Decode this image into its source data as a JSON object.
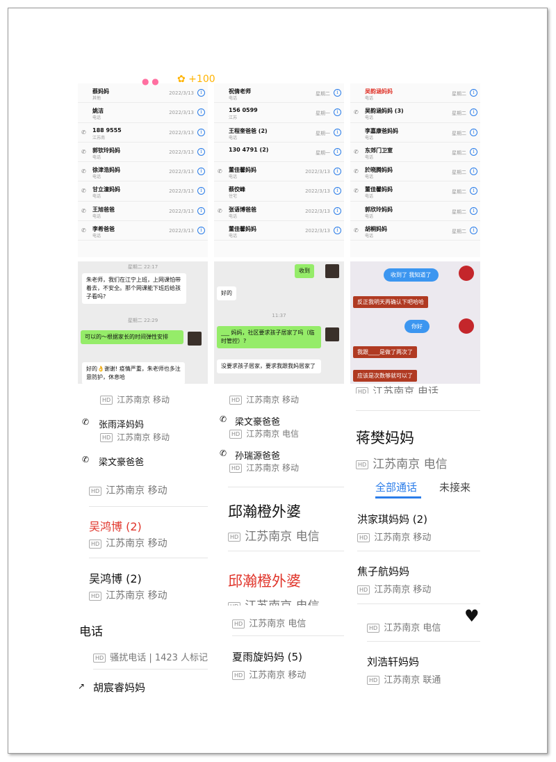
{
  "panel1_calls": [
    {
      "name": "蔡妈妈",
      "sub": "其他",
      "date": "2022/3/13",
      "phone": false,
      "red": false
    },
    {
      "name": "姚洁",
      "sub": "电话",
      "date": "2022/3/13",
      "phone": false,
      "red": false
    },
    {
      "name": "188 9555",
      "sub": "江苏南",
      "date": "2022/3/13",
      "phone": true,
      "red": false
    },
    {
      "name": "郭钦玲妈妈",
      "sub": "电话",
      "date": "2022/3/13",
      "phone": true,
      "red": false
    },
    {
      "name": "徐津浩妈妈",
      "sub": "电话",
      "date": "2022/3/13",
      "phone": true,
      "red": false
    },
    {
      "name": "甘立潼妈妈",
      "sub": "电话",
      "date": "2022/3/13",
      "phone": true,
      "red": false
    },
    {
      "name": "王旭爸爸",
      "sub": "电话",
      "date": "2022/3/13",
      "phone": true,
      "red": false
    },
    {
      "name": "李希爸爸",
      "sub": "电话",
      "date": "2022/3/13",
      "phone": true,
      "red": false
    }
  ],
  "panel2_calls": [
    {
      "name": "祝倩老师",
      "sub": "电话",
      "date": "星期二",
      "phone": false,
      "red": false
    },
    {
      "name": "156 0599",
      "sub": "江苏",
      "date": "星期一",
      "phone": false,
      "red": false
    },
    {
      "name": "王程奎爸爸 (2)",
      "sub": "电话",
      "date": "星期一",
      "phone": false,
      "red": false
    },
    {
      "name": "130 4791 (2)",
      "sub": "",
      "date": "星期一",
      "phone": false,
      "red": false
    },
    {
      "name": "董佳馨妈妈",
      "sub": "电话",
      "date": "2022/3/13",
      "phone": true,
      "red": false
    },
    {
      "name": "蔡佼峰",
      "sub": "住宅",
      "date": "2022/3/13",
      "phone": false,
      "red": false
    },
    {
      "name": "张语博爸爸",
      "sub": "电话",
      "date": "2022/3/13",
      "phone": true,
      "red": false
    },
    {
      "name": "董佳馨妈妈",
      "sub": "电话",
      "date": "2022/3/13",
      "phone": false,
      "red": false
    }
  ],
  "panel3_calls": [
    {
      "name": "吴韵涵妈妈",
      "sub": "电话",
      "date": "星期二",
      "phone": false,
      "red": true
    },
    {
      "name": "吴韵涵妈妈 (3)",
      "sub": "电话",
      "date": "星期二",
      "phone": true,
      "red": false
    },
    {
      "name": "李嘉康爸妈妈",
      "sub": "电话",
      "date": "星期二",
      "phone": false,
      "red": false
    },
    {
      "name": "东郊门卫室",
      "sub": "电话",
      "date": "星期二",
      "phone": true,
      "red": false
    },
    {
      "name": "於晓腾妈妈",
      "sub": "电话",
      "date": "星期二",
      "phone": true,
      "red": false
    },
    {
      "name": "董佳馨妈妈",
      "sub": "电话",
      "date": "星期二",
      "phone": true,
      "red": false
    },
    {
      "name": "郭欣玲妈妈",
      "sub": "电话",
      "date": "星期二",
      "phone": false,
      "red": false
    },
    {
      "name": "胡桐妈妈",
      "sub": "电话",
      "date": "星期二",
      "phone": true,
      "red": false
    }
  ],
  "chat1": {
    "time1": "星期二 22:17",
    "msg1": "朱老师，我们在江宁上班，上网课怕带着去，不安全。那个网课能下班后给孩子看吗?",
    "time2": "星期二 22:29",
    "reply": "可以的～根据家长的时间弹性安排",
    "msg2": "好的👌谢谢! 疫情严重，朱老师也多注意防护，休息哈"
  },
  "chat2": {
    "top": "收到",
    "ok": "好的",
    "time": "11:37",
    "q": "___ 妈妈，社区要求孩子居家了吗（临时管控）?",
    "a": "没要求孩子居家，要求我跟我妈居家了"
  },
  "chat3": {
    "m1": "收到了 我知道了",
    "m2": "反正我明天再确认下吧哈哈",
    "m3": "你好",
    "m4": "我跟____是做了两次了",
    "m5": "应该是次数够就可以了"
  },
  "col1": {
    "partial_top": "江苏南京 移动",
    "r1_name": "张雨泽妈妈",
    "r1_sub": "江苏南京 移动",
    "r2_name": "梁文豪爸爸",
    "r3_sub": "江苏南京 移动",
    "r4_name": "吴鸿博 (2)",
    "r4_sub": "江苏南京 移动",
    "r5_name": "吴鸿博 (2)",
    "r5_sub": "江苏南京 移动",
    "r6_name": "电话",
    "r6_sub": "骚扰电话 | 1423 人标记",
    "r7_name": "胡宸睿妈妈"
  },
  "col2": {
    "partial_top": "江苏南京 移动",
    "r1_name": "梁文豪爸爸",
    "r1_sub": "江苏南京 电信",
    "r2_name": "孙瑞源爸爸",
    "r2_sub": "江苏南京 移动",
    "r3_name": "邱瀚橙外婆",
    "r3_sub": "江苏南京 电信",
    "r4_name": "邱瀚橙外婆",
    "r4_sub": "江苏南京 电信",
    "r5_sub": "江苏南京 电信",
    "r6_name": "夏雨旋妈妈 (5)",
    "r6_sub": "江苏南京 移动"
  },
  "col3": {
    "partial_top": "江苏南京 电话",
    "r1_name": "蒋樊妈妈",
    "r1_sub": "江苏南京 电信",
    "tab_all": "全部通话",
    "tab_missed": "未接来",
    "r2_name": "洪家琪妈妈 (2)",
    "r2_sub": "江苏南京 移动",
    "r3_name": "焦子航妈妈",
    "r3_sub": "江苏南京 移动",
    "r4_sub": "江苏南京 电信",
    "r5_name": "刘浩轩妈妈",
    "r5_sub": "江苏南京 联通"
  },
  "hd_badge": "HD",
  "colors": {
    "accent": "#2b7de9",
    "missed": "#e0352b",
    "wechat_green": "#95ec69",
    "red_bubble": "#b03a22"
  }
}
